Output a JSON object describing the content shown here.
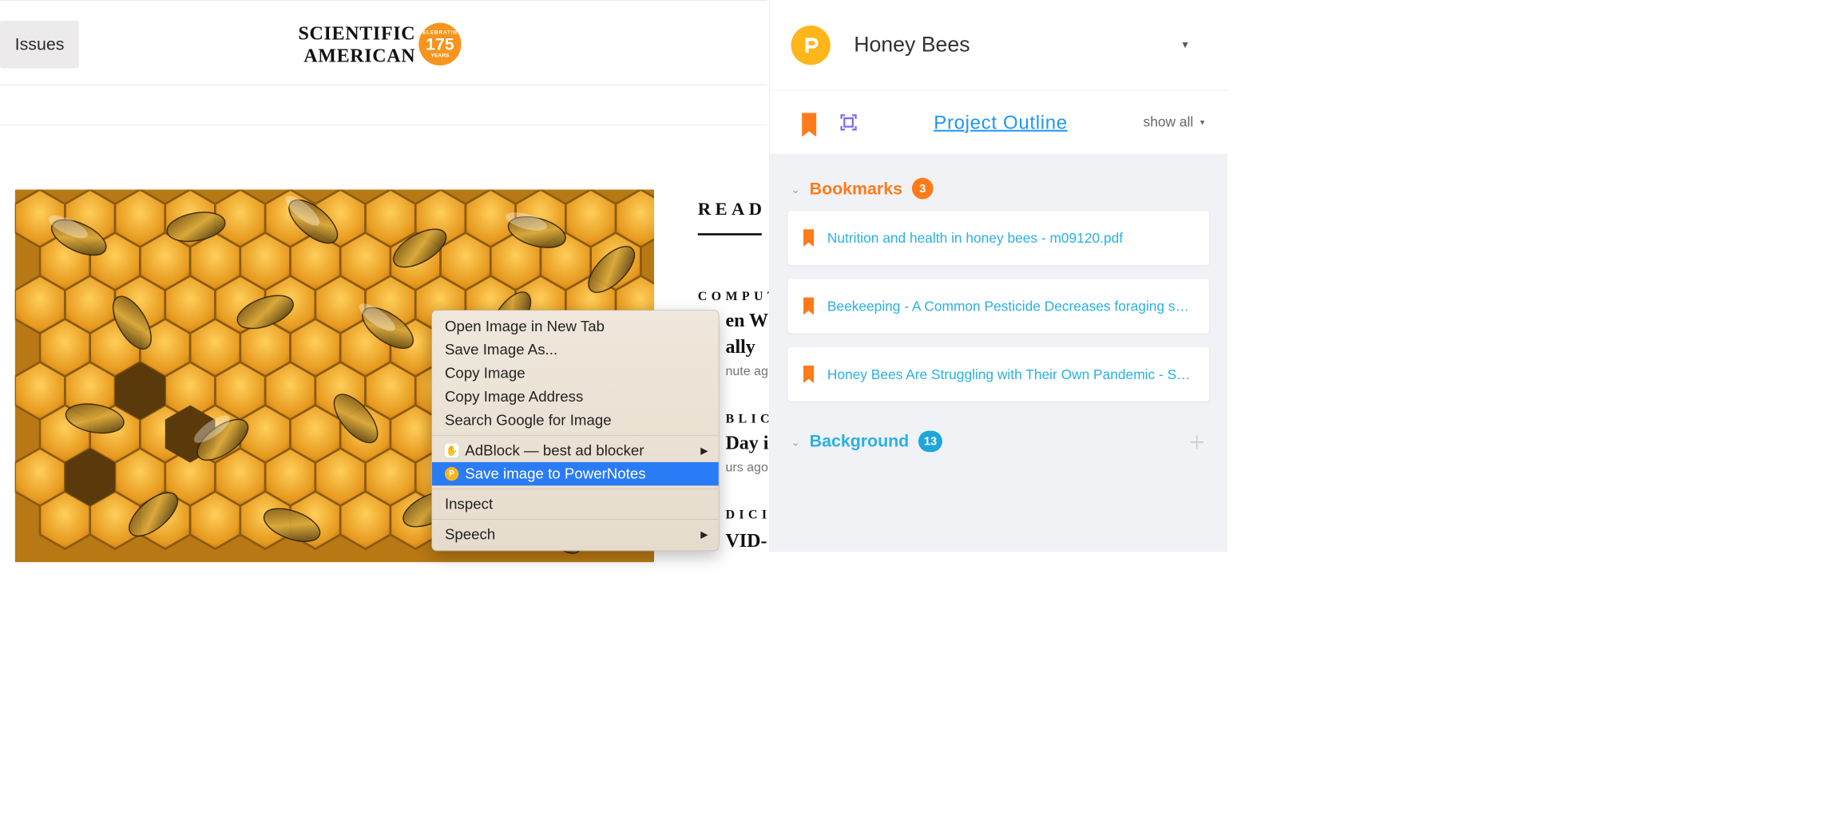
{
  "page": {
    "issues_button": "Issues",
    "brand_line1": "SCIENTIFIC",
    "brand_line2": "AMERICAN",
    "brand_badge_top": "CELEBRATING",
    "brand_badge_number": "175",
    "brand_badge_bottom": "YEARS",
    "read_label": "READ",
    "read_items": [
      {
        "category": "COMPUT",
        "title_frag": "en W",
        "title_frag2": "ally",
        "meta_frag": "nute ag"
      },
      {
        "category": "BLIC",
        "title_frag": "Day i",
        "meta_frag": "urs ago"
      },
      {
        "category": "DICI",
        "title_frag": "VID-"
      }
    ]
  },
  "context_menu": {
    "open_new_tab": "Open Image in New Tab",
    "save_as": "Save Image As...",
    "copy_image": "Copy Image",
    "copy_addr": "Copy Image Address",
    "search_google": "Search Google for Image",
    "adblock": "AdBlock — best ad blocker",
    "save_powernotes": "Save image to PowerNotes",
    "inspect": "Inspect",
    "speech": "Speech"
  },
  "sidebar": {
    "project_name": "Honey Bees",
    "outline_link": "Project Outline",
    "show_all": "show all",
    "sections": {
      "bookmarks": {
        "title": "Bookmarks",
        "count": "3"
      },
      "background": {
        "title": "Background",
        "count": "13"
      }
    },
    "bookmarks": [
      "Nutrition and health in honey bees - m09120.pdf",
      "Beekeeping - A Common Pesticide Decreases foraging success a...",
      "Honey Bees Are Struggling with Their Own Pandemic - Scientific ..."
    ]
  }
}
